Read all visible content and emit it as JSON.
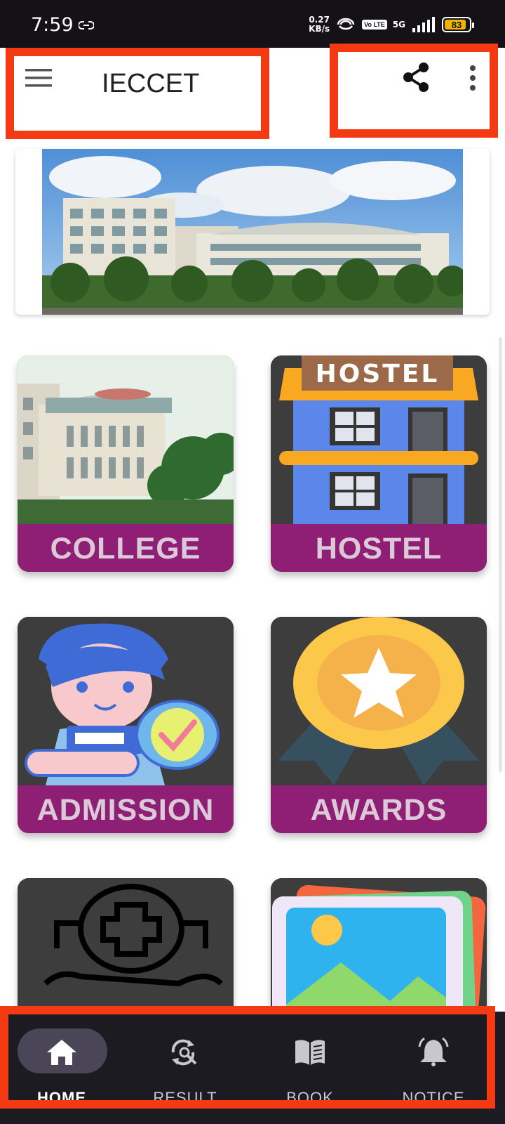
{
  "status_bar": {
    "time": "7:59",
    "net_speed_value": "0.27",
    "net_speed_unit": "KB/s",
    "volte": "Vo LTE",
    "network": "5G",
    "battery": "83"
  },
  "app_bar": {
    "title": "IECCET"
  },
  "tiles": [
    {
      "label": "COLLEGE"
    },
    {
      "label": "HOSTEL",
      "sign": "HOSTEL"
    },
    {
      "label": "ADMISSION"
    },
    {
      "label": "AWARDS"
    }
  ],
  "bottom_nav": {
    "items": [
      {
        "label": "HOME",
        "icon": "home-icon",
        "active": true
      },
      {
        "label": "RESULT",
        "icon": "result-search-icon",
        "active": false
      },
      {
        "label": "BOOK",
        "icon": "book-icon",
        "active": false
      },
      {
        "label": "NOTICE",
        "icon": "bell-icon",
        "active": false
      }
    ]
  },
  "colors": {
    "highlight_box": "#f33a12",
    "tile_label_bg": "#8e1f75",
    "tile_bg": "#3d3d3d",
    "nav_bg": "#1c1b22"
  }
}
